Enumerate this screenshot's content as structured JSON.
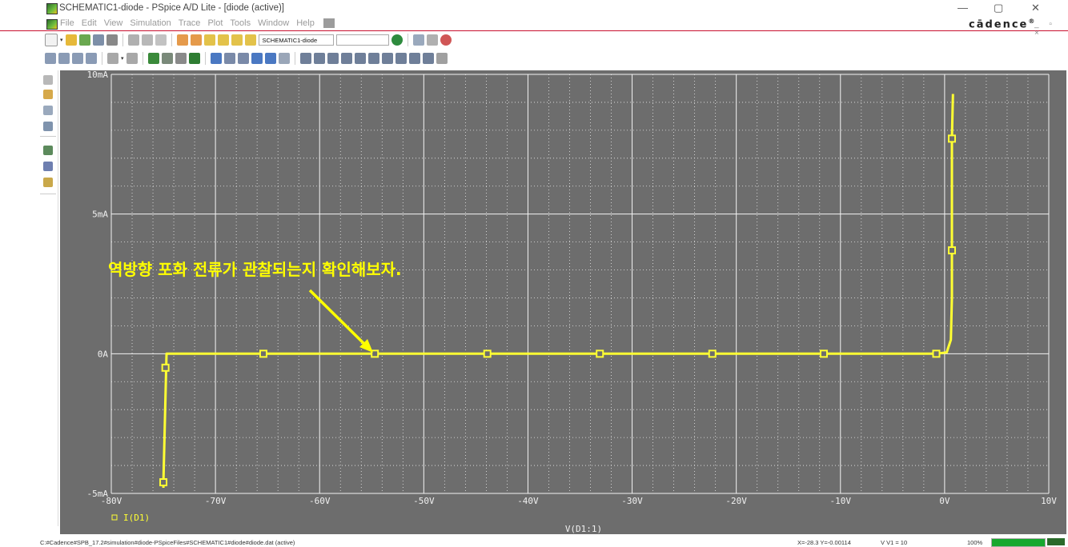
{
  "window": {
    "title": "SCHEMATIC1-diode - PSpice A/D Lite - [diode (active)]",
    "brand": "cādence",
    "controls": {
      "minimize": "—",
      "maximize": "▢",
      "close": "✕"
    },
    "mdi_controls": "_ ▫ ×"
  },
  "menu": {
    "items": [
      "File",
      "Edit",
      "View",
      "Simulation",
      "Trace",
      "Plot",
      "Tools",
      "Window",
      "Help"
    ]
  },
  "toolbar": {
    "simulation_profile": "SCHEMATIC1-diode",
    "search_value": ""
  },
  "plot": {
    "annotation": "역방향 포화 전류가 관찰되는지 확인해보자.",
    "trace_label": "I(D1)",
    "background": "#6d6d6d",
    "trace_color": "#ffff33",
    "annotation_color": "#ffff00"
  },
  "chart_data": {
    "type": "line",
    "xlabel": "V(D1:1)",
    "ylabel": "",
    "xlim": [
      -80,
      10
    ],
    "ylim": [
      -5,
      10
    ],
    "x_ticks": [
      "-80V",
      "-70V",
      "-60V",
      "-50V",
      "-40V",
      "-30V",
      "-20V",
      "-10V",
      "0V",
      "10V"
    ],
    "y_ticks": [
      "-5mA",
      "0A",
      "5mA",
      "10mA"
    ],
    "grid": true,
    "series": [
      {
        "name": "I(D1)",
        "x": [
          -75,
          -75,
          -74.7,
          -65.4,
          -54.7,
          -43.9,
          -33.1,
          -22.3,
          -11.6,
          -0.8,
          0.2,
          0.6,
          0.7,
          0.7,
          0.7,
          0.8
        ],
        "y": [
          -4.8,
          -4.6,
          0,
          0,
          0,
          0,
          0,
          0,
          0,
          0,
          0.05,
          0.5,
          2.0,
          3.7,
          7.7,
          9.3
        ],
        "markers_x": [
          -75,
          -74.8,
          -65.4,
          -54.7,
          -43.9,
          -33.1,
          -22.3,
          -11.6,
          -0.8,
          0.7,
          0.7
        ],
        "markers_y": [
          -4.6,
          -0.5,
          0,
          0,
          0,
          0,
          0,
          0,
          0,
          3.7,
          7.7
        ]
      }
    ]
  },
  "status": {
    "path": "C:#Cadence#SPB_17.2#simulation#diode-PSpiceFiles#SCHEMATIC1#diode#diode.dat (active)",
    "cursor": "X=-28.3  Y=-0.00114",
    "source": "V V1 = 10",
    "progress": "100%"
  }
}
